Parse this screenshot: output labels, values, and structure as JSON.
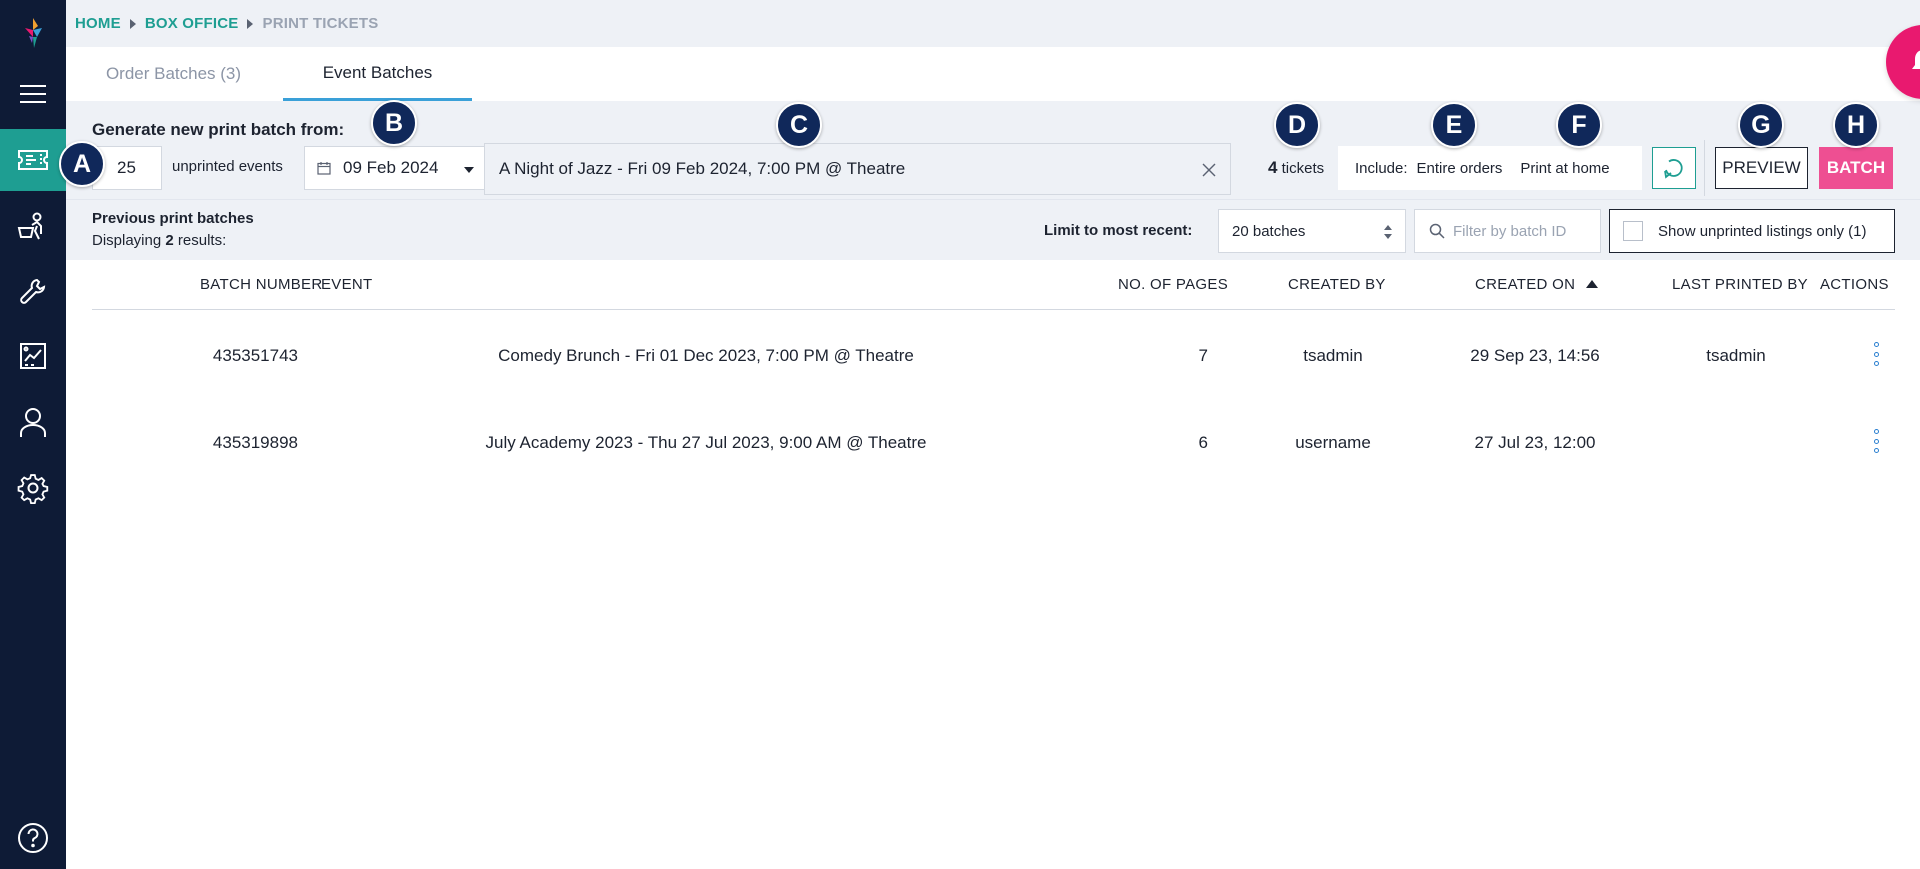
{
  "breadcrumb": {
    "home": "HOME",
    "box_office": "BOX OFFICE",
    "current": "PRINT TICKETS"
  },
  "tabs": {
    "order_batches": "Order Batches (3)",
    "event_batches": "Event Batches"
  },
  "generate": {
    "title": "Generate new print batch from:",
    "count_value": "25",
    "unprinted_label": "unprinted events",
    "date_value": "09 Feb 2024",
    "event_value": "A Night of Jazz - Fri 09 Feb 2024, 7:00 PM @ Theatre",
    "tickets_count": "4",
    "tickets_label": "tickets",
    "include_label": "Include:",
    "include_option1": "Entire orders",
    "include_option2": "Print at home",
    "preview_label": "PREVIEW",
    "batch_label": "BATCH"
  },
  "badges": {
    "a": "A",
    "b": "B",
    "c": "C",
    "d": "D",
    "e": "E",
    "f": "F",
    "g": "G",
    "h": "H"
  },
  "previous": {
    "title": "Previous print batches",
    "displaying_prefix": "Displaying",
    "displaying_count": "2",
    "displaying_suffix": "results:",
    "limit_label": "Limit to most recent:",
    "limit_value": "20 batches",
    "filter_placeholder": "Filter by batch ID",
    "show_unprinted_label": "Show unprinted listings only (1)"
  },
  "table": {
    "headers": {
      "batch_number": "BATCH NUMBER",
      "event": "EVENT",
      "pages": "NO. OF PAGES",
      "created_by": "CREATED BY",
      "created_on": "CREATED ON",
      "last_printed_by": "LAST PRINTED BY",
      "actions": "ACTIONS"
    },
    "rows": [
      {
        "batch_number": "435351743",
        "event": "Comedy Brunch - Fri 01 Dec 2023, 7:00 PM @ Theatre",
        "pages": "7",
        "created_by": "tsadmin",
        "created_on": "29 Sep 23, 14:56",
        "last_printed_by": "tsadmin"
      },
      {
        "batch_number": "435319898",
        "event": "July Academy 2023 - Thu 27 Jul 2023, 9:00 AM @ Theatre",
        "pages": "6",
        "created_by": "username",
        "created_on": "27 Jul 23, 12:00",
        "last_printed_by": ""
      }
    ]
  },
  "colors": {
    "sidebar": "#0e1b36",
    "accent": "#1e9e92",
    "batch_button": "#ee4f92",
    "bell": "#e9196f",
    "badge": "#10285a"
  }
}
